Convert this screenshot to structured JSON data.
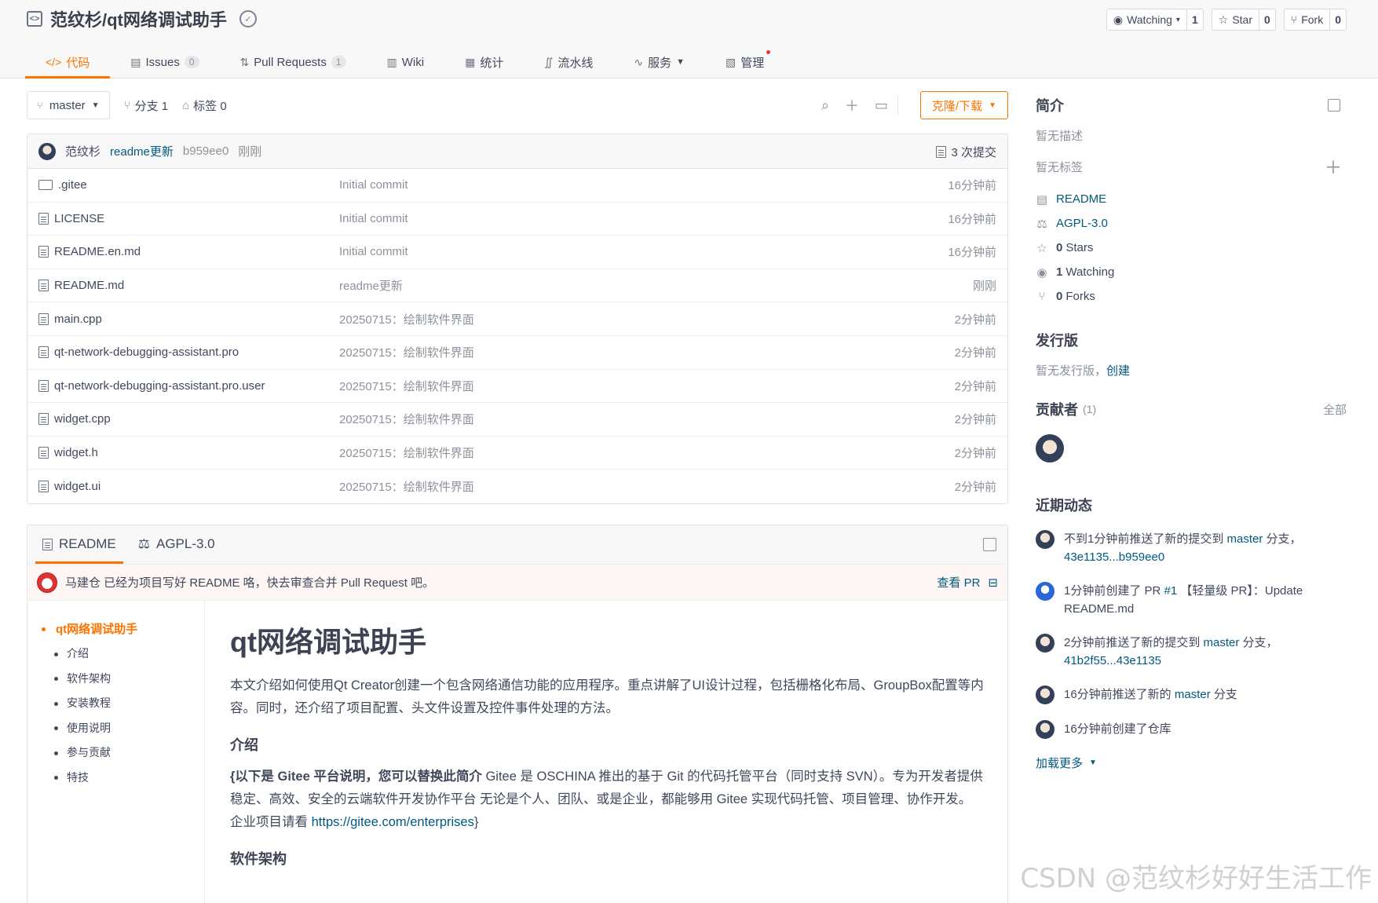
{
  "repo": {
    "title": "范纹杉/qt网络调试助手",
    "watching_label": "Watching",
    "watching_count": "1",
    "star_label": "Star",
    "star_count": "0",
    "fork_label": "Fork",
    "fork_count": "0"
  },
  "tabs": [
    {
      "label": "代码",
      "count": ""
    },
    {
      "label": "Issues",
      "count": "0"
    },
    {
      "label": "Pull Requests",
      "count": "1"
    },
    {
      "label": "Wiki",
      "count": ""
    },
    {
      "label": "统计",
      "count": ""
    },
    {
      "label": "流水线",
      "count": ""
    },
    {
      "label": "服务",
      "count": ""
    },
    {
      "label": "管理",
      "count": ""
    }
  ],
  "toolbar": {
    "branch": "master",
    "branches": "分支 1",
    "tags": "标签 0",
    "clone": "克隆/下载"
  },
  "commit": {
    "author": "范纹杉",
    "message": "readme更新",
    "hash": "b959ee0",
    "time": "刚刚",
    "count": "3 次提交"
  },
  "files": [
    {
      "name": ".gitee",
      "type": "dir",
      "msg": "Initial commit",
      "time": "16分钟前"
    },
    {
      "name": "LICENSE",
      "type": "file",
      "msg": "Initial commit",
      "time": "16分钟前"
    },
    {
      "name": "README.en.md",
      "type": "file",
      "msg": "Initial commit",
      "time": "16分钟前"
    },
    {
      "name": "README.md",
      "type": "file",
      "msg": "readme更新",
      "time": "刚刚"
    },
    {
      "name": "main.cpp",
      "type": "file",
      "msg": "20250715：绘制软件界面",
      "time": "2分钟前"
    },
    {
      "name": "qt-network-debugging-assistant.pro",
      "type": "file",
      "msg": "20250715：绘制软件界面",
      "time": "2分钟前"
    },
    {
      "name": "qt-network-debugging-assistant.pro.user",
      "type": "file",
      "msg": "20250715：绘制软件界面",
      "time": "2分钟前"
    },
    {
      "name": "widget.cpp",
      "type": "file",
      "msg": "20250715：绘制软件界面",
      "time": "2分钟前"
    },
    {
      "name": "widget.h",
      "type": "file",
      "msg": "20250715：绘制软件界面",
      "time": "2分钟前"
    },
    {
      "name": "widget.ui",
      "type": "file",
      "msg": "20250715：绘制软件界面",
      "time": "2分钟前"
    }
  ],
  "readme": {
    "tab_readme": "README",
    "tab_license": "AGPL-3.0",
    "pr_notice": "马建仓 已经为项目写好 README 咯，快去审查合并 Pull Request 吧。",
    "pr_link": "查看 PR",
    "toc": [
      "qt网络调试助手",
      "介绍",
      "软件架构",
      "安装教程",
      "使用说明",
      "参与贡献",
      "特技"
    ],
    "h1": "qt网络调试助手",
    "intro": "本文介绍如何使用Qt Creator创建一个包含网络通信功能的应用程序。重点讲解了UI设计过程，包括栅格化布局、GroupBox配置等内容。同时，还介绍了项目配置、头文件设置及控件事件处理的方法。",
    "h_intro": "介绍",
    "p_bold": "{以下是 Gitee 平台说明，您可以替换此简介",
    "p_rest": " Gitee 是 OSCHINA 推出的基于 Git 的代码托管平台（同时支持 SVN）。专为开发者提供稳定、高效、安全的云端软件开发协作平台 无论是个人、团队、或是企业，都能够用 Gitee 实现代码托管、项目管理、协作开发。企业项目请看 ",
    "p_link": "https://gitee.com/enterprises",
    "p_end": "}",
    "h_arch": "软件架构"
  },
  "sidebar": {
    "intro_title": "简介",
    "no_desc": "暂无描述",
    "no_tags": "暂无标签",
    "readme": "README",
    "license": "AGPL-3.0",
    "stars_num": "0",
    "stars": "Stars",
    "watching_num": "1",
    "watching": "Watching",
    "forks_num": "0",
    "forks": "Forks",
    "release_title": "发行版",
    "no_release": "暂无发行版，",
    "create": "创建",
    "contrib_title": "贡献者",
    "contrib_count": "(1)",
    "all": "全部",
    "activity_title": "近期动态",
    "activities": [
      {
        "pre": "不到1分钟前推送了新的提交到 ",
        "hl1": "master",
        "mid": " 分支，",
        "hl2": "43e1135...b959ee0",
        "post": ""
      },
      {
        "pre": "1分钟前创建了 PR ",
        "hl1": "#1",
        "mid": " 【轻量级 PR】：Update README.md",
        "hl2": "",
        "post": ""
      },
      {
        "pre": "2分钟前推送了新的提交到 ",
        "hl1": "master",
        "mid": " 分支，",
        "hl2": "41b2f55...43e1135",
        "post": ""
      },
      {
        "pre": "16分钟前推送了新的 ",
        "hl1": "master",
        "mid": " 分支",
        "hl2": "",
        "post": ""
      },
      {
        "pre": "16分钟前创建了仓库",
        "hl1": "",
        "mid": "",
        "hl2": "",
        "post": ""
      }
    ],
    "load_more": "加载更多"
  },
  "watermark": "CSDN @范纹杉好好生活工作",
  "colors": {
    "accent": "#fe7300",
    "link": "#005980",
    "muted": "#8c929c"
  }
}
